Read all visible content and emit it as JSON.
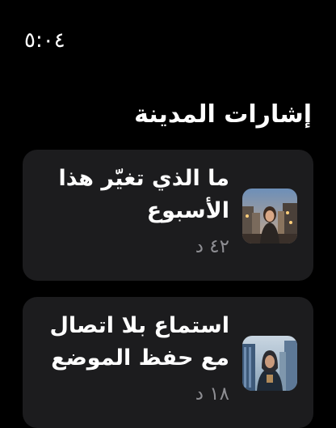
{
  "status_bar": {
    "time": "٥:٠٤"
  },
  "section": {
    "title": "إشارات المدينة"
  },
  "cards": [
    {
      "title": "ما الذي تغيّر هذا الأسبوع",
      "meta": "٤٢ د",
      "thumbnail_icon": "woman-city-street-photo"
    },
    {
      "title": "استماع بلا اتصال مع حفظ الموضع",
      "meta": "١٨ د",
      "thumbnail_icon": "woman-hijab-city-photo"
    }
  ]
}
